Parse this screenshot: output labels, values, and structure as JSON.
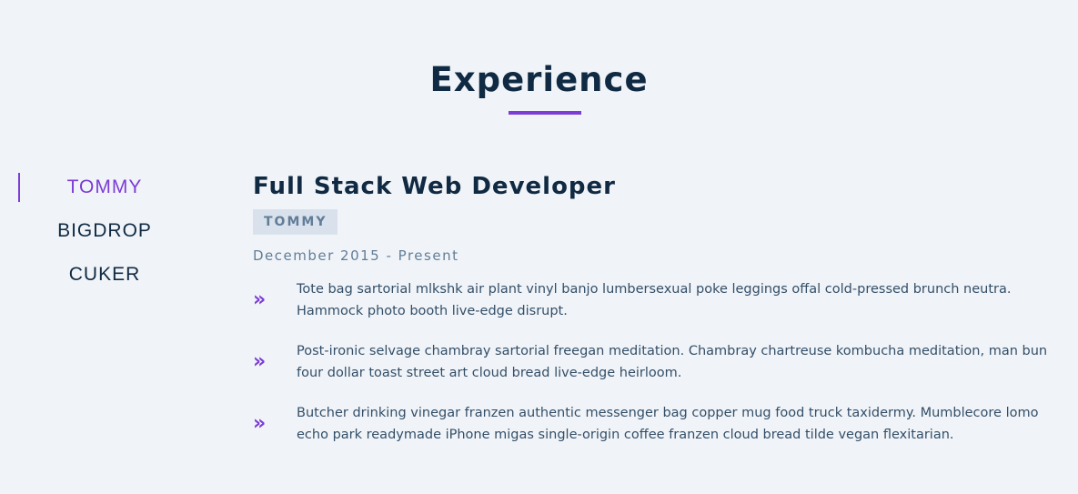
{
  "section": {
    "title": "Experience"
  },
  "tabs": [
    {
      "label": "TOMMY",
      "active": true
    },
    {
      "label": "BIGDROP",
      "active": false
    },
    {
      "label": "CUKER",
      "active": false
    }
  ],
  "job": {
    "title": "Full Stack Web Developer",
    "company": "TOMMY",
    "dates": "December 2015 - Present",
    "duties": [
      "Tote bag sartorial mlkshk air plant vinyl banjo lumbersexual poke leggings offal cold-pressed brunch neutra. Hammock photo booth live-edge disrupt.",
      "Post-ironic selvage chambray sartorial freegan meditation. Chambray chartreuse kombucha meditation, man bun four dollar toast street art cloud bread live-edge heirloom.",
      "Butcher drinking vinegar franzen authentic messenger bag copper mug food truck taxidermy. Mumblecore lomo echo park readymade iPhone migas single-origin coffee franzen cloud bread tilde vegan flexitarian."
    ]
  },
  "icons": {
    "duty_bullet": "double-chevron-right-icon"
  },
  "colors": {
    "accent": "#7c3cd6",
    "heading": "#102a43",
    "muted": "#627d98",
    "badge_bg": "#d9e2ec",
    "background": "#f0f4f8"
  }
}
